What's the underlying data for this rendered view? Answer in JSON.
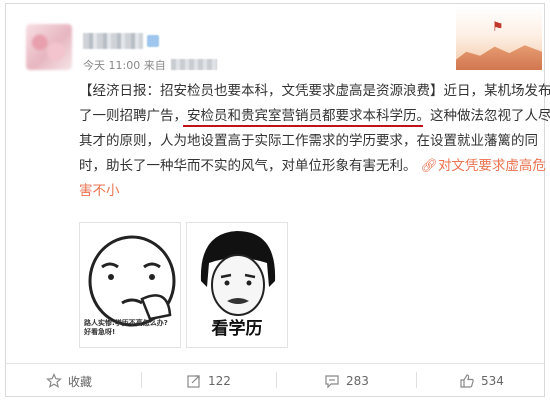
{
  "post": {
    "time": "今天 11:00 来自",
    "text_lines": [
      "【经济日报：招安检员也要本科，文凭要求虚高是资源浪费】近日，某机场发布",
      "了一则招聘广告，",
      "。这种做法忽视了人尽",
      "其才的原则，人为地设置高于实际工作需求的学历要求，在设置就业藩篱的同",
      "时，助长了一种华而不实的风气，对单位形象有害无利。",
      "害不小"
    ],
    "highlight": "安检员和贵宾室营销员都要求本科学历",
    "link_text": "对文凭要求虚高危"
  },
  "images": [
    {
      "caption_line1": "路人实惨:学历不高怎么办?",
      "caption_line2": "好看急呀!"
    },
    {
      "caption": "看学历"
    }
  ],
  "actions": {
    "favorite": "收藏",
    "repost": "122",
    "comment": "283",
    "like": "534"
  },
  "colors": {
    "link": "#eb7350",
    "underline": "#c0121b",
    "text": "#333333"
  }
}
